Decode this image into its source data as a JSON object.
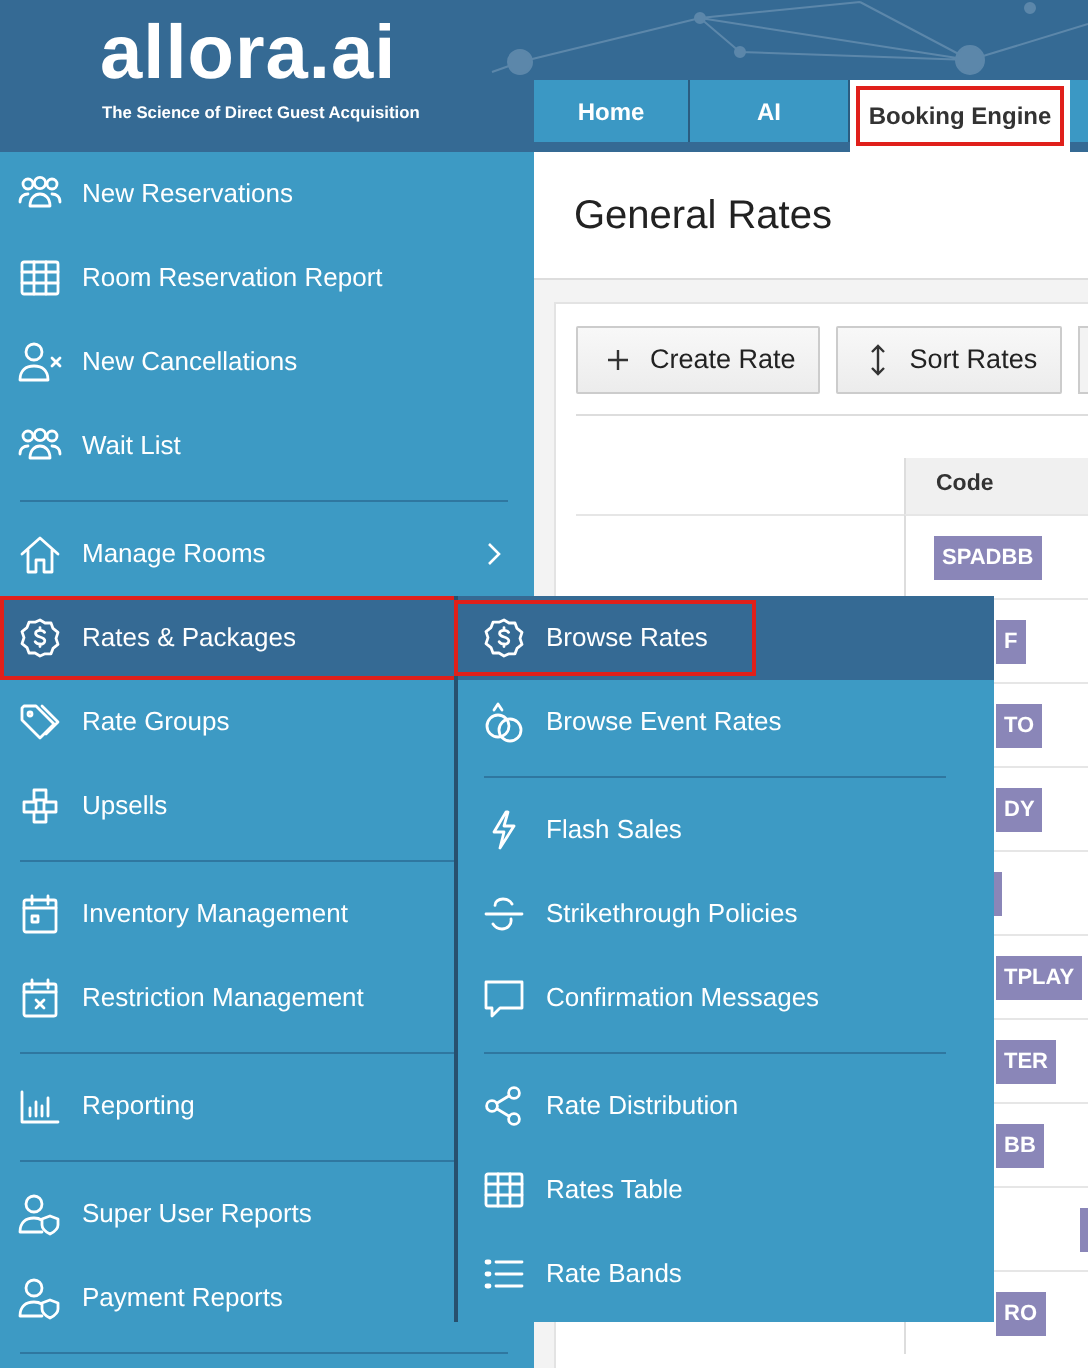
{
  "header": {
    "logo": "allora.ai",
    "tagline": "The Science of Direct Guest Acquisition"
  },
  "tabs": [
    {
      "label": "Home",
      "selected": false,
      "highlighted": false
    },
    {
      "label": "AI",
      "selected": false,
      "highlighted": false
    },
    {
      "label": "Booking Engine",
      "selected": true,
      "highlighted": true
    }
  ],
  "sidebar": {
    "items": [
      {
        "kind": "item",
        "label": "New Reservations",
        "selected": false,
        "highlighted": false
      },
      {
        "kind": "item",
        "label": "Room Reservation Report",
        "selected": false,
        "highlighted": false
      },
      {
        "kind": "item",
        "label": "New Cancellations",
        "selected": false,
        "highlighted": false
      },
      {
        "kind": "item",
        "label": "Wait List",
        "selected": false,
        "highlighted": false
      },
      {
        "kind": "divider"
      },
      {
        "kind": "item",
        "label": "Manage Rooms",
        "selected": false,
        "highlighted": false,
        "chevron": true
      },
      {
        "kind": "item",
        "label": "Rates & Packages",
        "selected": true,
        "highlighted": true
      },
      {
        "kind": "item",
        "label": "Rate Groups",
        "selected": false,
        "highlighted": false
      },
      {
        "kind": "item",
        "label": "Upsells",
        "selected": false,
        "highlighted": false
      },
      {
        "kind": "divider"
      },
      {
        "kind": "item",
        "label": "Inventory Management",
        "selected": false,
        "highlighted": false
      },
      {
        "kind": "item",
        "label": "Restriction Management",
        "selected": false,
        "highlighted": false
      },
      {
        "kind": "divider"
      },
      {
        "kind": "item",
        "label": "Reporting",
        "selected": false,
        "highlighted": false
      },
      {
        "kind": "divider"
      },
      {
        "kind": "item",
        "label": "Super User Reports",
        "selected": false,
        "highlighted": false
      },
      {
        "kind": "item",
        "label": "Payment Reports",
        "selected": false,
        "highlighted": false
      },
      {
        "kind": "divider"
      }
    ]
  },
  "submenu": {
    "items": [
      {
        "kind": "item",
        "label": "Browse Rates",
        "selected": true,
        "highlighted": true
      },
      {
        "kind": "item",
        "label": "Browse Event Rates",
        "selected": false,
        "highlighted": false
      },
      {
        "kind": "divider"
      },
      {
        "kind": "item",
        "label": "Flash Sales",
        "selected": false,
        "highlighted": false
      },
      {
        "kind": "item",
        "label": "Strikethrough Policies",
        "selected": false,
        "highlighted": false
      },
      {
        "kind": "item",
        "label": "Confirmation Messages",
        "selected": false,
        "highlighted": false
      },
      {
        "kind": "divider"
      },
      {
        "kind": "item",
        "label": "Rate Distribution",
        "selected": false,
        "highlighted": false
      },
      {
        "kind": "item",
        "label": "Rates Table",
        "selected": false,
        "highlighted": false
      },
      {
        "kind": "item",
        "label": "Rate Bands",
        "selected": false,
        "highlighted": false
      }
    ]
  },
  "main": {
    "title": "General Rates",
    "toolbar": [
      {
        "kind": "plus",
        "label": "Create Rate"
      },
      {
        "kind": "sort",
        "label": "Sort Rates"
      },
      {
        "kind": "cut"
      }
    ],
    "table": {
      "columns": [
        "Code"
      ],
      "rows": [
        {
          "kind": "code",
          "code": "SPADBB"
        },
        {
          "kind": "code",
          "code": "F"
        },
        {
          "kind": "code",
          "code": "TO"
        },
        {
          "kind": "code",
          "code": "DY"
        },
        {
          "kind": "sliver"
        },
        {
          "kind": "code",
          "code": "TPLAY"
        },
        {
          "kind": "code",
          "code": "TER"
        },
        {
          "kind": "code",
          "code": "BB"
        },
        {
          "kind": "offset-sliver"
        },
        {
          "kind": "code",
          "code": "RO"
        }
      ]
    }
  }
}
